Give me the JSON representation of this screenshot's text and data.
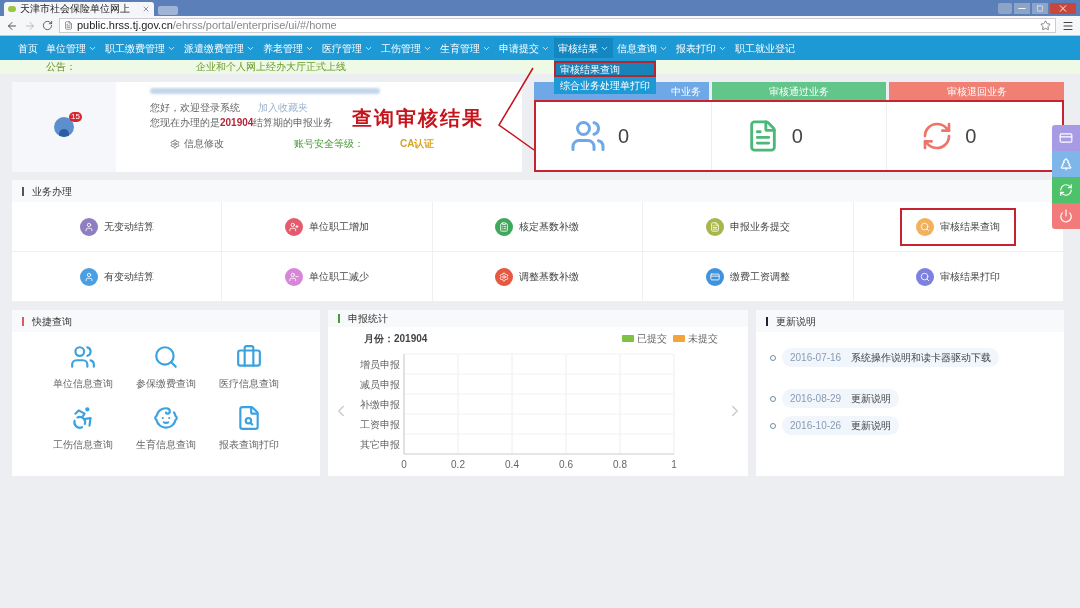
{
  "browser": {
    "tab_title": "天津市社会保险单位网上",
    "url_host": "public.hrss.tj.gov.cn",
    "url_path": "/ehrss/portal/enterprise/ui/#/home"
  },
  "nav": [
    {
      "label": "首页",
      "has_menu": false,
      "expanded": false
    },
    {
      "label": "单位管理",
      "has_menu": true,
      "expanded": false
    },
    {
      "label": "职工缴费管理",
      "has_menu": true,
      "expanded": false
    },
    {
      "label": "派遣缴费管理",
      "has_menu": true,
      "expanded": false
    },
    {
      "label": "养老管理",
      "has_menu": true,
      "expanded": false
    },
    {
      "label": "医疗管理",
      "has_menu": true,
      "expanded": false
    },
    {
      "label": "工伤管理",
      "has_menu": true,
      "expanded": false
    },
    {
      "label": "生育管理",
      "has_menu": true,
      "expanded": false
    },
    {
      "label": "申请提交",
      "has_menu": true,
      "expanded": false
    },
    {
      "label": "审核结果",
      "has_menu": true,
      "expanded": true,
      "menu": [
        {
          "label": "审核结果查询",
          "highlighted": true
        },
        {
          "label": "综合业务处理单打印",
          "highlighted": false
        }
      ]
    },
    {
      "label": "信息查询",
      "has_menu": true,
      "expanded": false
    },
    {
      "label": "报表打印",
      "has_menu": true,
      "expanded": false
    },
    {
      "label": "职工就业登记",
      "has_menu": false,
      "expanded": false
    }
  ],
  "notice": {
    "label": "公告：",
    "text": "企业和个人网上经办大厅正式上线"
  },
  "profile": {
    "badge": "15",
    "greeting": "您好，欢迎登录系统",
    "favorite_link": "加入收藏夹",
    "period_text": "您现在办理的是**201904**结算期的申报业务",
    "edit_link": "信息修改",
    "security_label": "账号安全等级：",
    "security_value": "CA认证"
  },
  "annotation": {
    "text": "查询审核结果"
  },
  "stats": {
    "highlighted": true,
    "items": [
      {
        "kind": "pending",
        "header": "中业务",
        "count": "0",
        "color": "#6fa8e6"
      },
      {
        "kind": "passed",
        "header": "审核通过业务",
        "count": "0",
        "color": "#62c58a"
      },
      {
        "kind": "returned",
        "header": "审核退回业务",
        "count": "0",
        "color": "#f07f74"
      }
    ]
  },
  "business": {
    "title": "业务办理",
    "items": [
      {
        "label": "无变动结算",
        "color": "#8f7fc0",
        "highlighted": false
      },
      {
        "label": "单位职工增加",
        "color": "#e65a6e",
        "highlighted": false
      },
      {
        "label": "核定基数补缴",
        "color": "#3fa85c",
        "highlighted": false
      },
      {
        "label": "申报业务提交",
        "color": "#a9b64c",
        "highlighted": false
      },
      {
        "label": "审核结果查询",
        "color": "#f2b15a",
        "highlighted": true
      },
      {
        "label": "有变动结算",
        "color": "#4a9fe3",
        "highlighted": false
      },
      {
        "label": "单位职工减少",
        "color": "#d786d8",
        "highlighted": false
      },
      {
        "label": "调整基数补缴",
        "color": "#e8573f",
        "highlighted": false
      },
      {
        "label": "缴费工资调整",
        "color": "#3f93dc",
        "highlighted": false
      },
      {
        "label": "审核结果打印",
        "color": "#7c81e2",
        "highlighted": false
      }
    ]
  },
  "quick": {
    "title": "快捷查询",
    "items": [
      {
        "kind": "unit",
        "label": "单位信息查询"
      },
      {
        "kind": "payment",
        "label": "参保缴费查询"
      },
      {
        "kind": "medical",
        "label": "医疗信息查询"
      },
      {
        "kind": "injury",
        "label": "工伤信息查询"
      },
      {
        "kind": "maternity",
        "label": "生育信息查询"
      },
      {
        "kind": "report",
        "label": "报表查询打印"
      }
    ]
  },
  "stats_chart": {
    "title": "申报统计",
    "month": "月份：201904",
    "chart_data": {
      "type": "bar",
      "orientation": "horizontal",
      "categories": [
        "增员申报",
        "减员申报",
        "补缴申报",
        "工资申报",
        "其它申报"
      ],
      "series": [
        {
          "name": "已提交",
          "color": "#7dc242",
          "values": [
            null,
            null,
            null,
            null,
            null
          ]
        },
        {
          "name": "未提交",
          "color": "#f3a43b",
          "values": [
            null,
            null,
            null,
            null,
            null
          ]
        }
      ],
      "grid": true,
      "xlim": [
        0,
        1
      ],
      "xticks": [
        {
          "value": 0,
          "label": "0"
        },
        {
          "value": 0.2,
          "label": "0.2"
        },
        {
          "value": 0.4,
          "label": "0.4"
        },
        {
          "value": 0.6,
          "label": "0.6"
        },
        {
          "value": 0.8,
          "label": "0.8"
        },
        {
          "value": 1,
          "label": "1"
        }
      ]
    }
  },
  "updates": {
    "title": "更新说明",
    "items": [
      {
        "date": "2016-07-16",
        "text": "系统操作说明和读卡器驱动下载"
      },
      {
        "date": "2016-08-29",
        "text": "更新说明"
      },
      {
        "date": "2016-10-26",
        "text": "更新说明"
      }
    ]
  }
}
